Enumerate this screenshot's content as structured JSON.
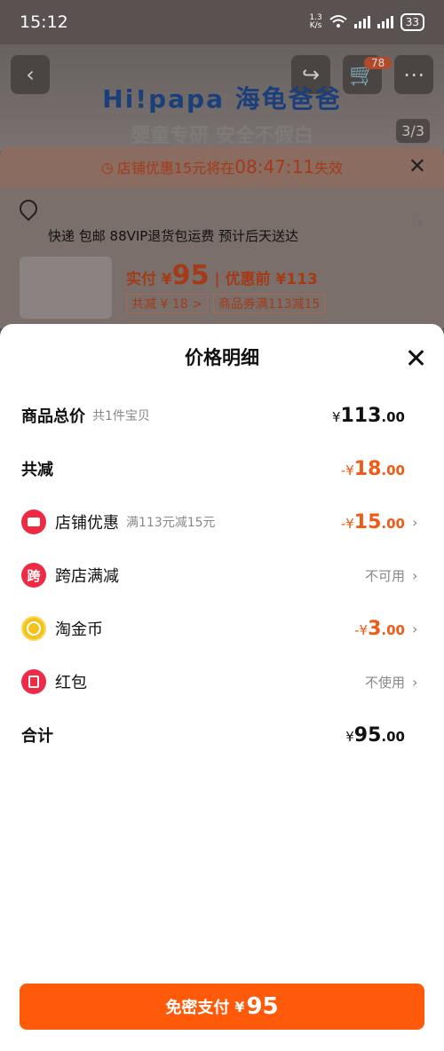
{
  "status_bar": {
    "time": "15:12",
    "speed_top": "1.3",
    "speed_bottom": "K/s",
    "battery": "33"
  },
  "background": {
    "brand": "Hi!papa 海龟爸爸",
    "slogan": "婴童专研 安全不假白",
    "cart_badge": "78",
    "image_counter": "3/3",
    "countdown_prefix": "店铺优惠15元将在",
    "countdown_time": "08:47:11",
    "countdown_suffix": "失效",
    "delivery_text": "快递 包邮 88VIP退货包运费 预计后天送达",
    "pay_label": "实付 ¥",
    "pay_amount": "95",
    "before_discount": "| 优惠前 ¥113",
    "tag_discount": "共减 ¥ 18 >",
    "tag_coupon": "商品券满113减15"
  },
  "dialog": {
    "title": "价格明细",
    "rows": {
      "total": {
        "label": "商品总价",
        "sub": "共1件宝贝",
        "cur": "¥",
        "int": "113",
        "dec": ".00"
      },
      "reduce": {
        "label": "共减",
        "cur": "-¥",
        "int": "18",
        "dec": ".00"
      },
      "store": {
        "label": "店铺优惠",
        "sub": "满113元减15元",
        "cur": "-¥",
        "int": "15",
        "dec": ".00"
      },
      "cross": {
        "label": "跨店满减",
        "icon_text": "跨",
        "value": "不可用"
      },
      "coin": {
        "label": "淘金币",
        "cur": "-¥",
        "int": "3",
        "dec": ".00"
      },
      "redpacket": {
        "label": "红包",
        "value": "不使用"
      },
      "sum": {
        "label": "合计",
        "cur": "¥",
        "int": "95",
        "dec": ".00"
      }
    },
    "pay_button": {
      "label": "免密支付",
      "cur": "¥",
      "amount": "95"
    }
  },
  "colors": {
    "accent": "#ff5a0a",
    "discount": "#f05a14",
    "icon_red": "#ee2a44",
    "coin": "#f4c21a"
  }
}
